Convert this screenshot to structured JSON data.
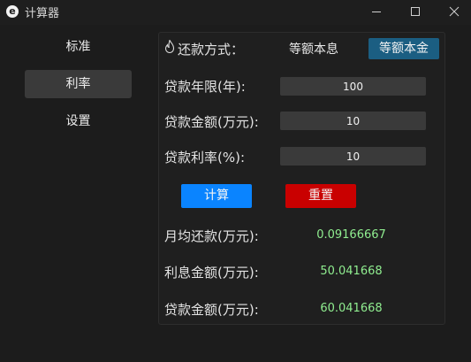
{
  "window": {
    "icon_letter": "e",
    "title": "计算器"
  },
  "sidebar": {
    "items": [
      {
        "label": "标准"
      },
      {
        "label": "利率"
      },
      {
        "label": "设置"
      }
    ]
  },
  "form": {
    "method_label": "还款方式：",
    "methods": [
      "等额本息",
      "等额本金"
    ],
    "selected_method": "等额本金",
    "years_label": "贷款年限(年):",
    "years_value": "100",
    "amount_label": "贷款金额(万元):",
    "amount_value": "10",
    "rate_label": "贷款利率(%):",
    "rate_value": "10",
    "calc_button": "计算",
    "reset_button": "重置"
  },
  "results": {
    "monthly_label": "月均还款(万元):",
    "monthly_value": "0.09166667",
    "interest_label": "利息金额(万元):",
    "interest_value": "50.041668",
    "total_label": "贷款金额(万元):",
    "total_value": "60.041668"
  },
  "colors": {
    "accent_blue": "#0a84ff",
    "reset_red": "#c90000",
    "selected_method_bg": "#1b5e82",
    "result_green": "#90ee90"
  },
  "icons": {
    "method": "flame-icon",
    "minimize": "minimize-icon",
    "maximize": "maximize-icon",
    "close": "close-icon"
  }
}
